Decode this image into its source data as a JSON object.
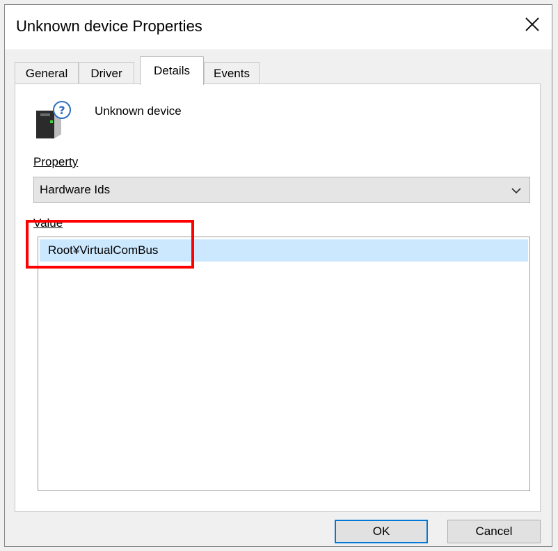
{
  "window": {
    "title": "Unknown device Properties"
  },
  "icons": {
    "close": "close-icon",
    "device": "unknown-device-icon",
    "dropdown": "chevron-down-icon"
  },
  "tabs": [
    {
      "label": "General"
    },
    {
      "label": "Driver"
    },
    {
      "label": "Details",
      "active": true
    },
    {
      "label": "Events"
    }
  ],
  "device": {
    "name": "Unknown device"
  },
  "property": {
    "label": "Property",
    "selected": "Hardware Ids"
  },
  "value": {
    "label": "Value",
    "items": [
      "Root¥VirtualComBus"
    ]
  },
  "buttons": {
    "ok": "OK",
    "cancel": "Cancel"
  },
  "colors": {
    "highlight": "#ff0000",
    "selection": "#cce8ff",
    "accent": "#0078d7"
  }
}
